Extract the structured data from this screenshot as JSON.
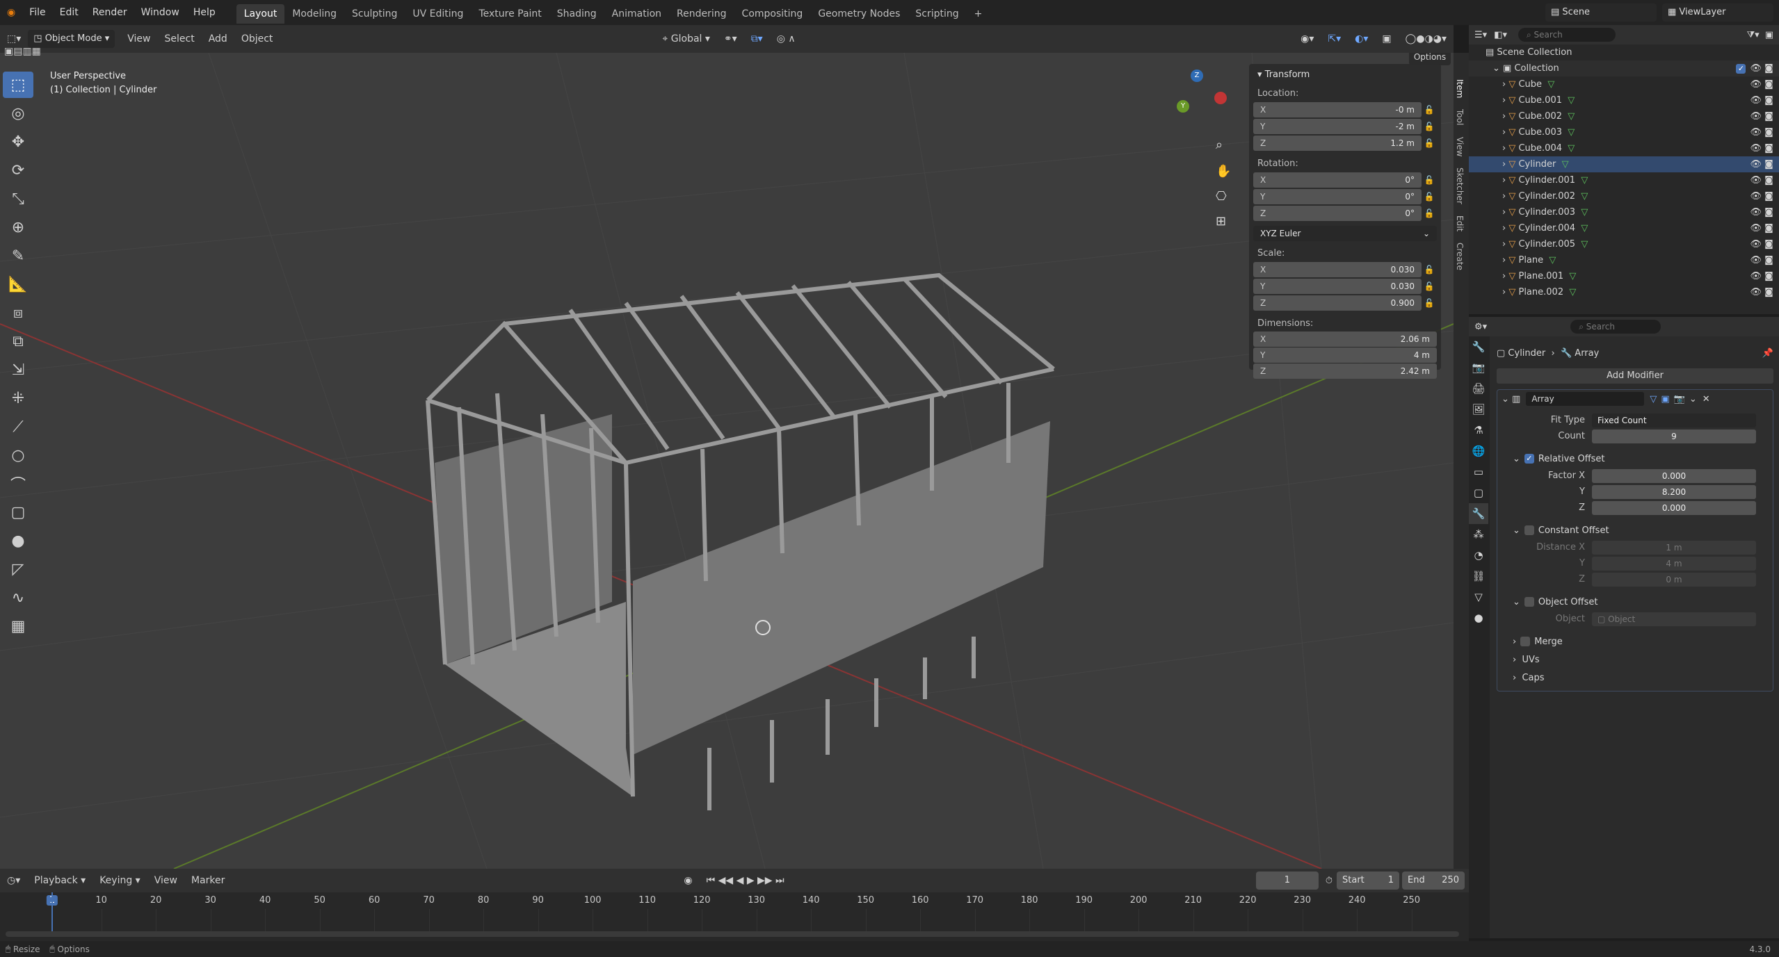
{
  "app": {
    "logo": "blender-logo",
    "version": "4.3.0"
  },
  "menu": [
    "File",
    "Edit",
    "Render",
    "Window",
    "Help"
  ],
  "workspaces": [
    {
      "label": "Layout",
      "active": true
    },
    {
      "label": "Modeling"
    },
    {
      "label": "Sculpting"
    },
    {
      "label": "UV Editing"
    },
    {
      "label": "Texture Paint"
    },
    {
      "label": "Shading"
    },
    {
      "label": "Animation"
    },
    {
      "label": "Rendering"
    },
    {
      "label": "Compositing"
    },
    {
      "label": "Geometry Nodes"
    },
    {
      "label": "Scripting"
    }
  ],
  "scene": {
    "name": "Scene",
    "view_layer": "ViewLayer"
  },
  "viewport_header": {
    "mode": "Object Mode",
    "menus": [
      "View",
      "Select",
      "Add",
      "Object"
    ],
    "orientation": "Global",
    "options_label": "Options"
  },
  "viewport": {
    "perspective": "User Perspective",
    "collection_info": "(1) Collection | Cylinder"
  },
  "npanel": {
    "tabs": [
      "Item",
      "Tool",
      "View",
      "Sketcher",
      "Edit",
      "Create"
    ],
    "title": "Transform",
    "location_label": "Location:",
    "location": [
      {
        "axis": "X",
        "value": "-0 m"
      },
      {
        "axis": "Y",
        "value": "-2 m"
      },
      {
        "axis": "Z",
        "value": "1.2 m"
      }
    ],
    "rotation_label": "Rotation:",
    "rotation": [
      {
        "axis": "X",
        "value": "0°"
      },
      {
        "axis": "Y",
        "value": "0°"
      },
      {
        "axis": "Z",
        "value": "0°"
      }
    ],
    "rotation_mode": "XYZ Euler",
    "scale_label": "Scale:",
    "scale": [
      {
        "axis": "X",
        "value": "0.030"
      },
      {
        "axis": "Y",
        "value": "0.030"
      },
      {
        "axis": "Z",
        "value": "0.900"
      }
    ],
    "dimensions_label": "Dimensions:",
    "dimensions": [
      {
        "axis": "X",
        "value": "2.06 m"
      },
      {
        "axis": "Y",
        "value": "4 m"
      },
      {
        "axis": "Z",
        "value": "2.42 m"
      }
    ]
  },
  "outliner": {
    "search_placeholder": "Search",
    "scene_collection": "Scene Collection",
    "collection": "Collection",
    "objects": [
      "Cube",
      "Cube.001",
      "Cube.002",
      "Cube.003",
      "Cube.004",
      "Cylinder",
      "Cylinder.001",
      "Cylinder.002",
      "Cylinder.003",
      "Cylinder.004",
      "Cylinder.005",
      "Plane",
      "Plane.001",
      "Plane.002"
    ]
  },
  "properties": {
    "search_placeholder": "Search",
    "object": "Cylinder",
    "modifier_crumb": "Array",
    "add_modifier": "Add Modifier",
    "modifier_name": "Array",
    "fit_type_label": "Fit Type",
    "fit_type": "Fixed Count",
    "count_label": "Count",
    "count": "9",
    "relative_offset": "Relative Offset",
    "factor_x_label": "Factor X",
    "factor_x": "0.000",
    "y_label": "Y",
    "factor_y": "8.200",
    "z_label": "Z",
    "factor_z": "0.000",
    "constant_offset": "Constant Offset",
    "distance_x_label": "Distance X",
    "distance_x": "1 m",
    "distance_y": "4 m",
    "distance_z": "0 m",
    "object_offset": "Object Offset",
    "object_label": "Object",
    "object_placeholder": "Object",
    "merge": "Merge",
    "uvs": "UVs",
    "caps": "Caps"
  },
  "timeline": {
    "menus": [
      "Playback",
      "Keying",
      "View",
      "Marker"
    ],
    "current_frame": "1",
    "start_label": "Start",
    "start": "1",
    "end_label": "End",
    "end": "250",
    "ruler": [
      "1",
      "10",
      "20",
      "30",
      "40",
      "50",
      "60",
      "70",
      "80",
      "90",
      "100",
      "110",
      "120",
      "130",
      "140",
      "150",
      "160",
      "170",
      "180",
      "190",
      "200",
      "210",
      "220",
      "230",
      "240",
      "250"
    ]
  },
  "status": {
    "left1": "Resize",
    "left2": "Options",
    "right": "4.3.0"
  }
}
